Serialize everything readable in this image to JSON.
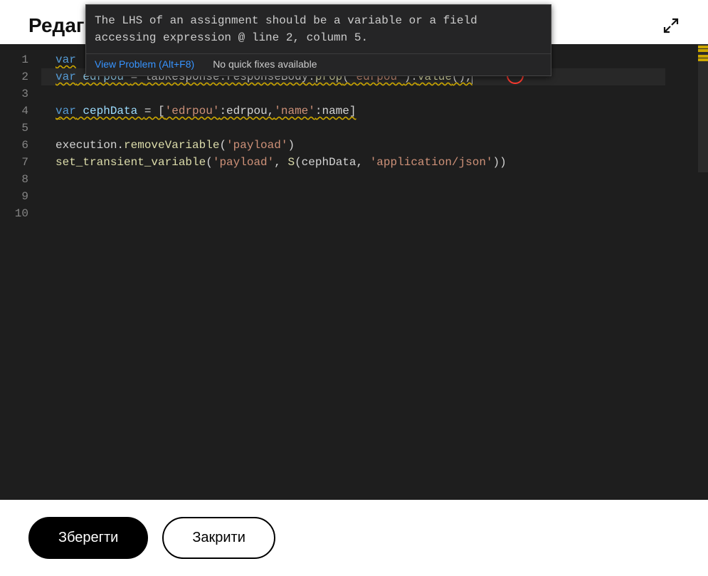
{
  "header": {
    "title": "Редаг"
  },
  "tooltip": {
    "message": "The LHS of an assignment should be a variable or a field accessing expression @ line 2, column 5.",
    "view_problem": "View Problem (Alt+F8)",
    "no_fixes": "No quick fixes available"
  },
  "code": {
    "line1_kw": "var",
    "line1_rest": " ",
    "line2_kw": "var",
    "line2_var": " edrpou ",
    "line2_eq": "= ",
    "line2_obj": "labResponse.responseBody.",
    "line2_fn1": "prop",
    "line2_p1a": "(",
    "line2_str1": "'edrpou'",
    "line2_p1b": ").",
    "line2_fn2": "value",
    "line2_p2": "(),",
    "line4_kw": "var",
    "line4_var": " cephData ",
    "line4_eq": "= [",
    "line4_s1": "'edrpou'",
    "line4_c1": ":edrpou,",
    "line4_s2": "'name'",
    "line4_c2": ":name]",
    "line6_obj": "execution.",
    "line6_fn": "removeVariable",
    "line6_p1": "(",
    "line6_str": "'payload'",
    "line6_p2": ")",
    "line7_fn1": "set_transient_variable",
    "line7_p1": "(",
    "line7_str1": "'payload'",
    "line7_c1": ", ",
    "line7_fn2": "S",
    "line7_p2": "(cephData, ",
    "line7_str2": "'application/json'",
    "line7_p3": "))"
  },
  "gutter": [
    "1",
    "2",
    "3",
    "4",
    "5",
    "6",
    "7",
    "8",
    "9",
    "10"
  ],
  "buttons": {
    "save": "Зберегти",
    "close": "Закрити"
  }
}
